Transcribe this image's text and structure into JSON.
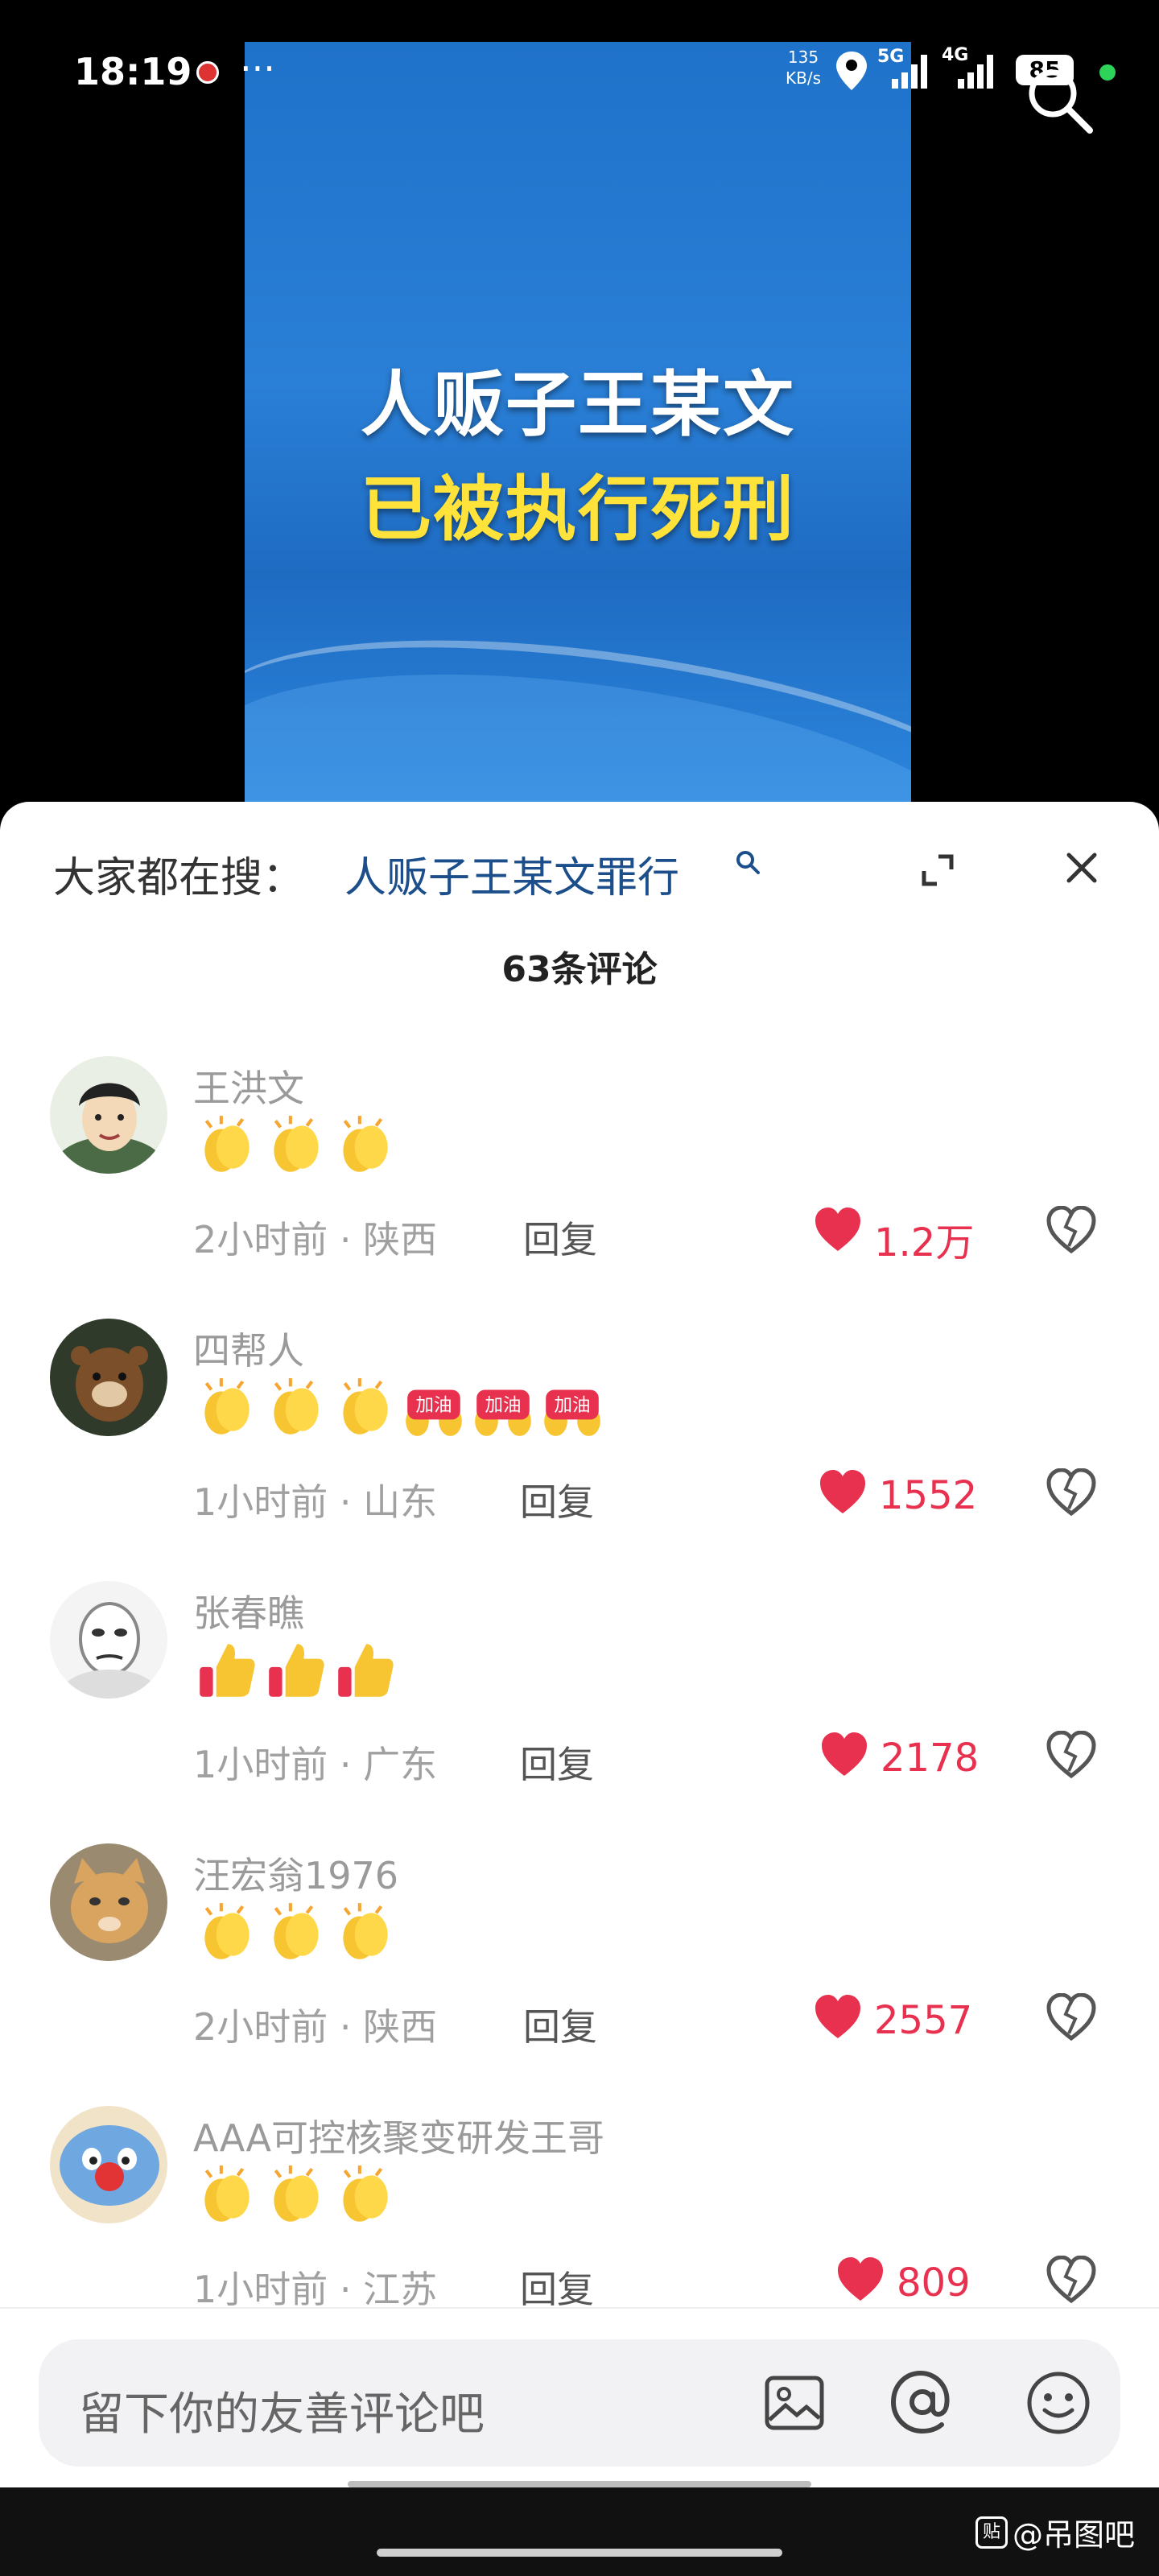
{
  "status_bar": {
    "time": "18:19",
    "more": "···",
    "net_speed_value": "135",
    "net_speed_unit": "KB/s",
    "net_5g": "5G",
    "net_4g": "4G",
    "battery": "85"
  },
  "video": {
    "title_line1": "人贩子王某文",
    "title_line2": "已被执行死刑"
  },
  "sheet": {
    "trend_prefix": "大家都在搜：",
    "trend_query": "人贩子王某文罪行",
    "comment_count": "63条评论"
  },
  "comments": [
    {
      "name": "王洪文",
      "time": "2小时前",
      "region": "陕西",
      "reply": "回复",
      "likes": "1.2万",
      "emojis": [
        "clap",
        "clap",
        "clap"
      ]
    },
    {
      "name": "四帮人",
      "time": "1小时前",
      "region": "山东",
      "reply": "回复",
      "likes": "1552",
      "emojis": [
        "clap",
        "clap",
        "clap",
        "jiayou",
        "jiayou",
        "jiayou"
      ],
      "badge_text": "加油"
    },
    {
      "name": "张春瞧",
      "time": "1小时前",
      "region": "广东",
      "reply": "回复",
      "likes": "2178",
      "emojis": [
        "thumb",
        "thumb",
        "thumb"
      ]
    },
    {
      "name": "汪宏翁1976",
      "time": "2小时前",
      "region": "陕西",
      "reply": "回复",
      "likes": "2557",
      "emojis": [
        "clap",
        "clap",
        "clap"
      ]
    },
    {
      "name": "AAA可控核聚变研发王哥",
      "time": "1小时前",
      "region": "江苏",
      "reply": "回复",
      "likes": "809",
      "emojis": [
        "clap",
        "clap",
        "clap"
      ]
    }
  ],
  "input": {
    "placeholder": "留下你的友善评论吧"
  },
  "watermark": {
    "box": "贴",
    "text": "@吊图吧"
  },
  "colors": {
    "like_red": "#e8304f",
    "link_blue": "#1b4e8a",
    "video_blue": "#2a7fd6",
    "title_yellow": "#ffe33a"
  }
}
